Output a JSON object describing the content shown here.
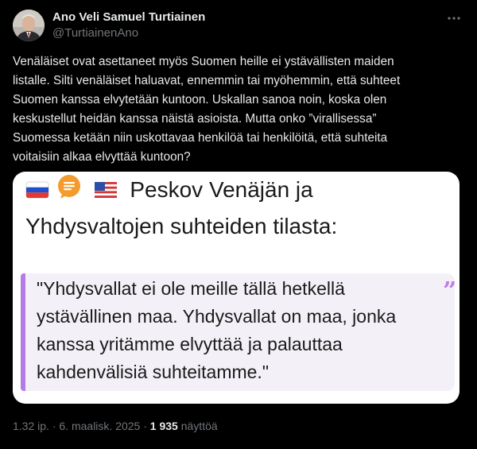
{
  "author": {
    "display_name": "Ano Veli Samuel Turtiainen",
    "handle": "@TurtiainenAno"
  },
  "tweet": {
    "text": "Venäläiset ovat asettaneet myös Suomen heille ei ystävällisten maiden\nlistalle. Silti venäläiset haluavat, ennemmin tai myöhemmin, että suhteet\nSuomen kanssa elvytetään kuntoon. Uskallan sanoa noin, koska olen\nkeskustellut heidän kanssa näistä asioista. Mutta onko ”virallisessa”\nSuomessa ketään niin uskottavaa henkilöä tai henkilöitä, että suhteita\nvoitaisiin alkaa elvyttää kuntoon?"
  },
  "media": {
    "title_line1": "Peskov Venäjän ja",
    "title_line2": "Yhdysvaltojen suhteiden tilasta:",
    "quote": " \"Yhdysvallat ei ole meille tällä hetkellä\nystävällinen maa. Yhdysvallat on maa, jonka\nkanssa yritämme elvyttää ja palauttaa\nkahdenvälisiä suhteitamme.\"",
    "quote_mark": "”",
    "icons": [
      "russia-flag-icon",
      "speech-bubble-icon",
      "usa-flag-icon"
    ],
    "colors": {
      "speech_bubble": "#f59b2b",
      "quote_accent": "#b57be6"
    }
  },
  "meta": {
    "time": "1.32 ip.",
    "separator": "·",
    "date": "6. maalisk. 2025",
    "views_count": "1 935",
    "views_label": "näyttöä"
  }
}
